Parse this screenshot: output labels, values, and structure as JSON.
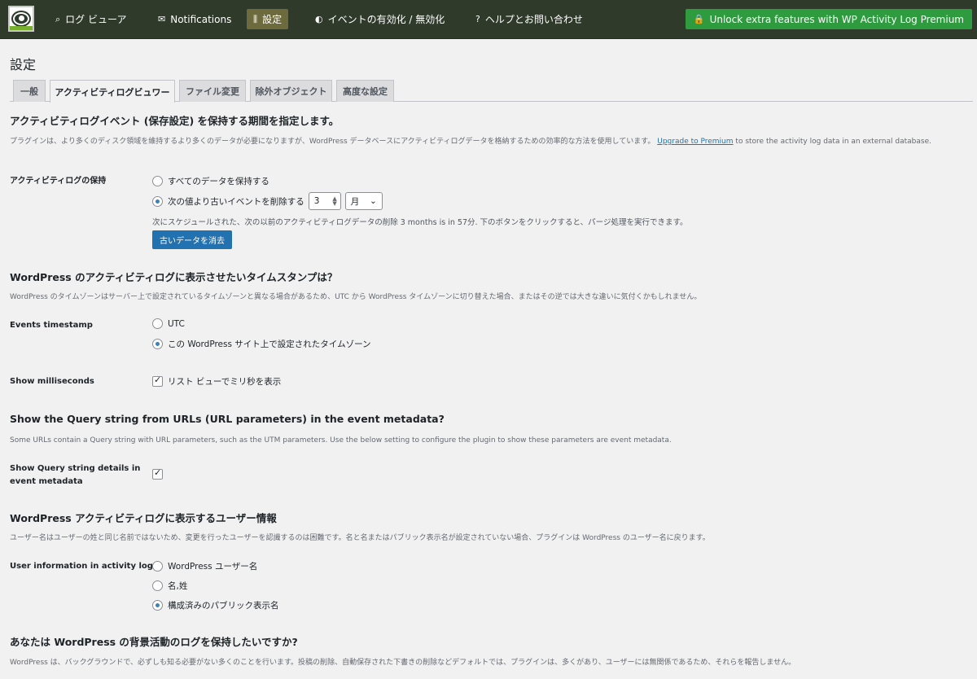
{
  "topbar": {
    "nav": [
      {
        "icon": "search-icon",
        "glyph": "⌕",
        "label": "ログ ビューア"
      },
      {
        "icon": "envelope-icon",
        "glyph": "✉",
        "label": "Notifications"
      },
      {
        "icon": "sliders-icon",
        "glyph": "⫼",
        "label": "設定"
      },
      {
        "icon": "toggle-icon",
        "glyph": "◐",
        "label": "イベントの有効化 / 無効化"
      },
      {
        "icon": "help-icon",
        "glyph": "?",
        "label": "ヘルプとお問い合わせ"
      }
    ],
    "unlock": {
      "icon": "lock-icon",
      "glyph": "🔒",
      "label": "Unlock extra features with WP Activity Log Premium"
    }
  },
  "page": {
    "title": "設定"
  },
  "tabs": [
    "一般",
    "アクティビティログビュワー",
    "ファイル変更",
    "除外オブジェクト",
    "高度な設定"
  ],
  "retention": {
    "heading": "アクティビティログイベント (保存設定) を保持する期間を指定します。",
    "desc_line1": "プラグインは、より多くのディスク領域を維持するより多くのデータが必要になりますが、WordPress データベースにアクティビティログデータを格納するための効率的な方法を使用しています。",
    "upgrade_link": "Upgrade to Premium",
    "desc_after_link": "to store the activity log data in an external",
    "desc_line2": "database.",
    "label": "アクティビティログの保持",
    "option_keep_all": "すべてのデータを保持する",
    "option_delete_older": "次の値より古いイベントを削除する",
    "number_value": "3",
    "unit_value": "月",
    "note": "次にスケジュールされた、次の以前のアクティビティログデータの削除 3 months is in 57分. 下のボタンをクリックすると、パージ処理を実行できます。",
    "purge_button": "古いデータを消去"
  },
  "timestamp": {
    "heading": "WordPress のアクティビティログに表示させたいタイムスタンプは？",
    "desc": "WordPress のタイムゾーンはサーバー上で設定されているタイムゾーンと異なる場合があるため、UTC から WordPress タイムゾーンに切り替えた場合、またはその逆では大きな違いに気付くかもしれません。",
    "label": "Events timestamp",
    "option_utc": "UTC",
    "option_site": "この WordPress サイト上で設定されたタイムゾーン",
    "ms_label": "Show milliseconds",
    "ms_option": "リスト ビューでミリ秒を表示"
  },
  "query": {
    "heading": "Show the Query string from URLs (URL parameters) in the event metadata?",
    "desc": "Some URLs contain a Query string with URL parameters, such as the UTM parameters. Use the below setting to configure the plugin to show these parameters are event metadata.",
    "label_line1": "Show Query string details in",
    "label_line2": "event metadata"
  },
  "userinfo": {
    "heading": "WordPress アクティビティログに表示するユーザー情報",
    "desc": "ユーザー名はユーザーの姓と同じ名前ではないため、変更を行ったユーザーを認識するのは困難です。名と名またはパブリック表示名が設定されていない場合、プラグインは WordPress のユーザー名に戻ります。",
    "label": "User information in activity log",
    "option_username": "WordPress ユーザー名",
    "option_name": "名,姓",
    "option_display": "構成済みのパブリック表示名"
  },
  "background": {
    "heading": "あなたは WordPress の背景活動のログを保持したいですか?",
    "desc": "WordPress は、バックグラウンドで、必ずしも知る必要がない多くのことを行います。投稿の削除、自動保存された下書きの削除などデフォルトでは、プラグインは、多くがあり、ユーザーには無関係であるため、それらを報告しません。"
  },
  "colors": {
    "topbar": "#2f3a2b",
    "active_nav": "#6d6b3d",
    "unlock": "#2e9b3f",
    "primary_button": "#2271b1",
    "link": "#2271b1"
  }
}
